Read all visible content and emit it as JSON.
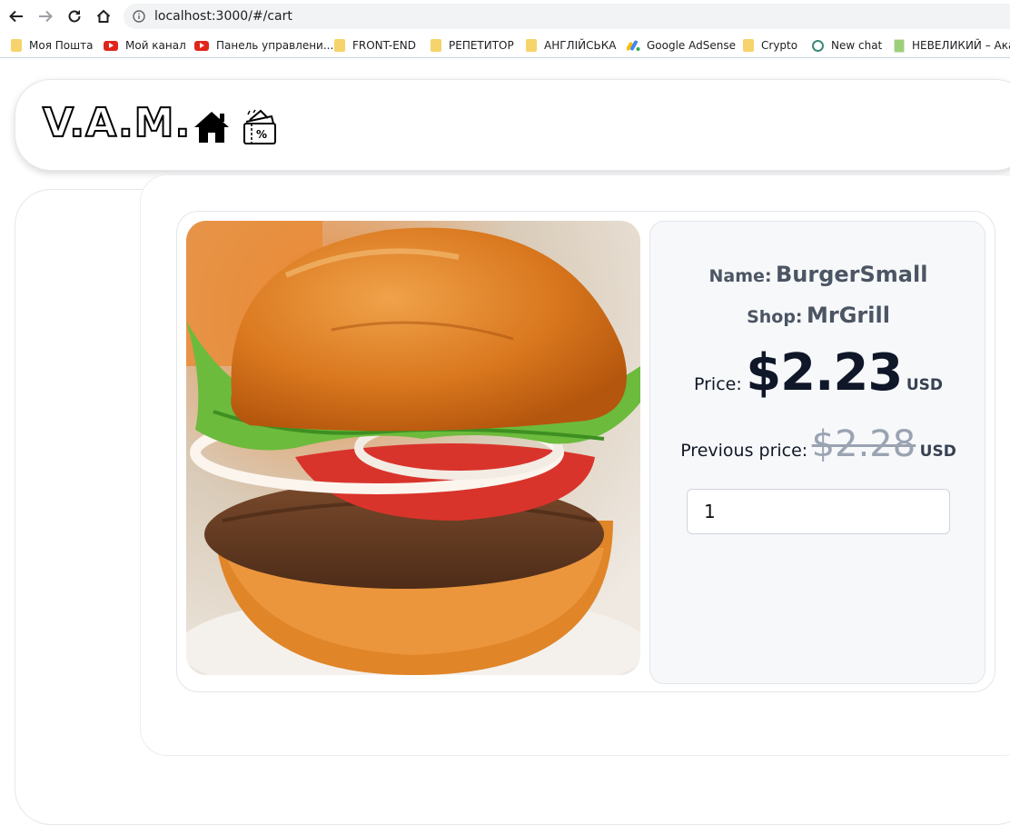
{
  "browser": {
    "url": "localhost:3000/#/cart",
    "bookmarks": [
      {
        "label": "Моя Пошта",
        "icon": "folder-icon"
      },
      {
        "label": "Мой канал",
        "icon": "youtube-icon"
      },
      {
        "label": "Панель управлени...",
        "icon": "youtube-icon"
      },
      {
        "label": "FRONT-END",
        "icon": "folder-icon"
      },
      {
        "label": "РЕПЕТИТОР",
        "icon": "folder-icon"
      },
      {
        "label": "АНГЛІЙСЬКА",
        "icon": "folder-icon"
      },
      {
        "label": "Google AdSense",
        "icon": "adsense-icon"
      },
      {
        "label": "Crypto",
        "icon": "folder-icon"
      },
      {
        "label": "New chat",
        "icon": "chatgpt-icon"
      },
      {
        "label": "НЕВЕЛИКИЙ – Ака...",
        "icon": "page-icon"
      }
    ]
  },
  "header": {
    "logo": "V.A.M."
  },
  "product": {
    "name_label": "Name:",
    "name": "BurgerSmall",
    "shop_label": "Shop:",
    "shop": "MrGrill",
    "price_label": "Price:",
    "price": "$2.23",
    "currency": "USD",
    "previous_price_label": "Previous price:",
    "previous_price": "$2.28",
    "previous_currency": "USD",
    "quantity": "1"
  },
  "colors": {
    "price": "#0f1729",
    "previous_price": "#9aa3b2",
    "panel_bg": "#f7f8fa"
  }
}
